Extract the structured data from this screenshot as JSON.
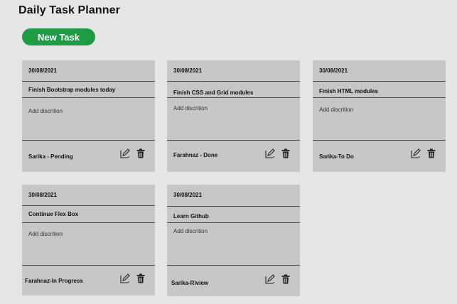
{
  "app": {
    "title": "Daily Task Planner",
    "new_task_label": "New Task"
  },
  "colors": {
    "background": "#e6e6e6",
    "card": "#c6c6c6",
    "accent": "#1f9a45"
  },
  "icons": {
    "edit": "edit-icon",
    "delete": "trash-icon"
  },
  "tasks": [
    {
      "date": "30/08/2021",
      "title": "Finish Bootstrap modules today",
      "description": "Add discrition",
      "status": "Sarika - Pending"
    },
    {
      "date": "30/08/2021",
      "title": "Finish CSS and Grid modules",
      "description": "Add discrition",
      "status": "Farahnaz - Done"
    },
    {
      "date": "30/08/2021",
      "title": "Finish HTML modules",
      "description": "Add discrition",
      "status": "Sarika-To Do"
    },
    {
      "date": "30/08/2021",
      "title": "Continue Flex Box",
      "description": "Add discrition",
      "status": "Farahnaz-In Progress"
    },
    {
      "date": "30/08/2021",
      "title": "Learn Github",
      "description": "Add discrition",
      "status": "Sarika-Riview"
    }
  ]
}
